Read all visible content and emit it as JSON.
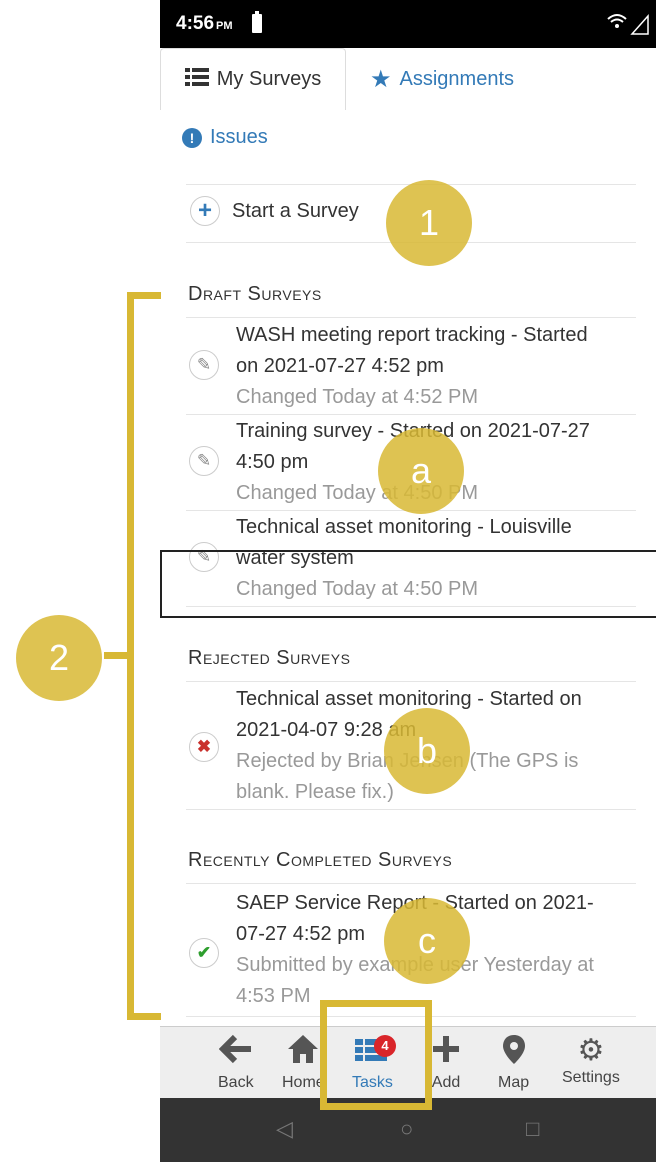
{
  "status_bar": {
    "time": "4:56",
    "ampm": "PM"
  },
  "tabs": [
    {
      "label": "My Surveys",
      "icon": "list-icon",
      "active": true
    },
    {
      "label": "Assignments",
      "icon": "star-icon",
      "active": false
    }
  ],
  "issues": {
    "label": "Issues"
  },
  "start": {
    "label": "Start a Survey"
  },
  "sections": {
    "draft": {
      "title": "Draft Surveys",
      "items": [
        {
          "line1": "WASH meeting report tracking - Started",
          "line2": "on 2021-07-27 4:52 pm",
          "line3": "Changed Today at 4:52 PM"
        },
        {
          "line1": "Training survey - Started on 2021-07-27",
          "line2": "4:50 pm",
          "line3": "Changed Today at 4:50 PM"
        },
        {
          "line1": "Technical asset monitoring - Louisville",
          "line2": "water system",
          "line3": "Changed Today at 4:50 PM"
        }
      ]
    },
    "rejected": {
      "title": "Rejected Surveys",
      "items": [
        {
          "line1": "Technical asset monitoring - Started on",
          "line2": "2021-04-07 9:28 am",
          "line3": "Rejected by Brian Jensen (The GPS is",
          "line4": "blank. Please fix.)"
        }
      ]
    },
    "completed": {
      "title": "Recently Completed Surveys",
      "items": [
        {
          "line1": "SAEP Service Report - Started on 2021-",
          "line2": "07-27 4:52 pm",
          "line3": "Submitted by example user Yesterday at",
          "line4": "4:53 PM"
        }
      ]
    }
  },
  "bottom_nav": [
    {
      "label": "Back",
      "icon": "arrow-left-icon"
    },
    {
      "label": "Home",
      "icon": "home-icon"
    },
    {
      "label": "Tasks",
      "icon": "tasks-icon",
      "badge": "4",
      "active": true
    },
    {
      "label": "Add",
      "icon": "plus-icon"
    },
    {
      "label": "Map",
      "icon": "map-pin-icon"
    },
    {
      "label": "Settings",
      "icon": "gear-icon"
    }
  ],
  "annotations": {
    "m1": "1",
    "m2": "2",
    "ma": "a",
    "mb": "b",
    "mc": "c"
  },
  "colors": {
    "accent": "#337ab7",
    "annotation": "#d8b834",
    "badge": "#d9252a"
  }
}
